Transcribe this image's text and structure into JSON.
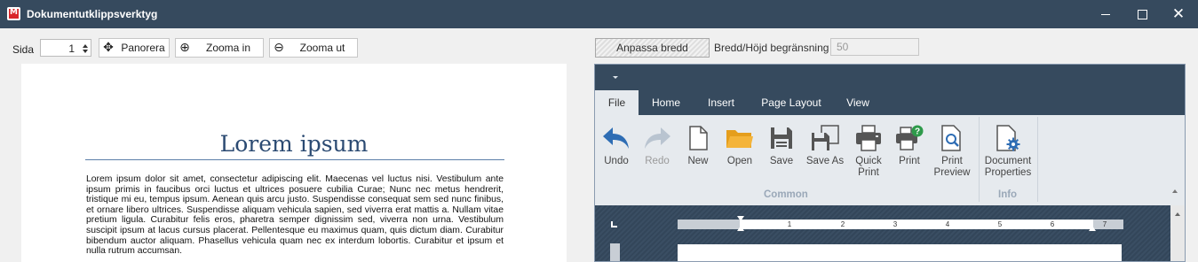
{
  "window": {
    "title": "Dokumentutklippsverktyg",
    "logo_text": "M",
    "close_glyph": "✕"
  },
  "toolbar": {
    "page_label": "Sida",
    "page_value": "1",
    "pan_label": "Panorera",
    "zoom_in_label": "Zooma in",
    "zoom_out_label": "Zooma ut",
    "pan_glyph": "✥",
    "zoom_in_glyph": "⊕",
    "zoom_out_glyph": "⊖"
  },
  "document": {
    "title": "Lorem ipsum",
    "body": "Lorem ipsum dolor sit amet, consectetur adipiscing elit. Maecenas vel luctus nisi. Vestibulum ante ipsum primis in faucibus orci luctus et ultrices posuere cubilia Curae; Nunc nec metus hendrerit, tristique mi eu, tempus ipsum. Aenean quis arcu justo. Suspendisse consequat sem sed nunc finibus, et ornare libero ultrices. Suspendisse aliquam vehicula sapien, sed viverra erat mattis a. Nullam vitae pretium ligula. Curabitur felis eros, pharetra semper dignissim sed, viverra non urna. Vestibulum suscipit ipsum at lacus cursus placerat. Pellentesque eu maximus quam, quis dictum diam. Curabitur bibendum auctor aliquam. Phasellus vehicula quam nec ex interdum lobortis. Curabitur et ipsum et nulla rutrum accumsan."
  },
  "fit": {
    "button_label": "Anpassa bredd",
    "limit_label": "Bredd/Höjd begränsning på",
    "limit_value": "50"
  },
  "ribbon": {
    "tabs": [
      "File",
      "Home",
      "Insert",
      "Page Layout",
      "View"
    ],
    "active_tab": "File",
    "buttons": {
      "undo": [
        "Undo",
        ""
      ],
      "redo": [
        "Redo",
        ""
      ],
      "new": [
        "New",
        ""
      ],
      "open": [
        "Open",
        ""
      ],
      "save": [
        "Save",
        ""
      ],
      "save_as": [
        "Save As",
        ""
      ],
      "quick_print": [
        "Quick",
        "Print"
      ],
      "print": [
        "Print",
        ""
      ],
      "print_preview": [
        "Print",
        "Preview"
      ],
      "doc_props": [
        "Document",
        "Properties"
      ]
    },
    "groups": {
      "common": "Common",
      "info": "Info"
    },
    "accent_color": "#2e6db4",
    "folder_color": "#f4b43a",
    "help_badge_color": "#2e9a4a"
  },
  "ruler": {
    "numbers": [
      "1",
      "2",
      "3",
      "4",
      "5",
      "6",
      "7"
    ]
  }
}
